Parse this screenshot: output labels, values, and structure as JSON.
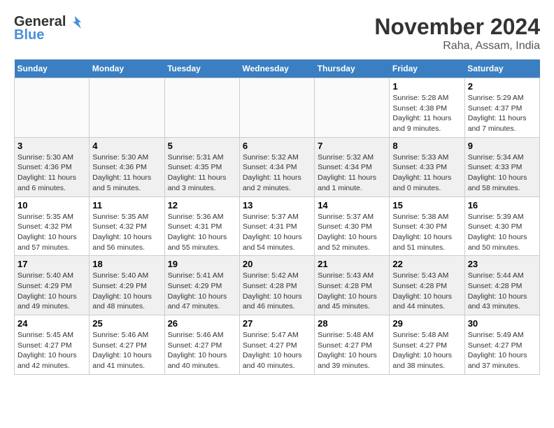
{
  "header": {
    "logo_line1": "General",
    "logo_line2": "Blue",
    "title": "November 2024",
    "location": "Raha, Assam, India"
  },
  "weekdays": [
    "Sunday",
    "Monday",
    "Tuesday",
    "Wednesday",
    "Thursday",
    "Friday",
    "Saturday"
  ],
  "weeks": [
    [
      {
        "day": "",
        "info": ""
      },
      {
        "day": "",
        "info": ""
      },
      {
        "day": "",
        "info": ""
      },
      {
        "day": "",
        "info": ""
      },
      {
        "day": "",
        "info": ""
      },
      {
        "day": "1",
        "info": "Sunrise: 5:28 AM\nSunset: 4:38 PM\nDaylight: 11 hours\nand 9 minutes."
      },
      {
        "day": "2",
        "info": "Sunrise: 5:29 AM\nSunset: 4:37 PM\nDaylight: 11 hours\nand 7 minutes."
      }
    ],
    [
      {
        "day": "3",
        "info": "Sunrise: 5:30 AM\nSunset: 4:36 PM\nDaylight: 11 hours\nand 6 minutes."
      },
      {
        "day": "4",
        "info": "Sunrise: 5:30 AM\nSunset: 4:36 PM\nDaylight: 11 hours\nand 5 minutes."
      },
      {
        "day": "5",
        "info": "Sunrise: 5:31 AM\nSunset: 4:35 PM\nDaylight: 11 hours\nand 3 minutes."
      },
      {
        "day": "6",
        "info": "Sunrise: 5:32 AM\nSunset: 4:34 PM\nDaylight: 11 hours\nand 2 minutes."
      },
      {
        "day": "7",
        "info": "Sunrise: 5:32 AM\nSunset: 4:34 PM\nDaylight: 11 hours\nand 1 minute."
      },
      {
        "day": "8",
        "info": "Sunrise: 5:33 AM\nSunset: 4:33 PM\nDaylight: 11 hours\nand 0 minutes."
      },
      {
        "day": "9",
        "info": "Sunrise: 5:34 AM\nSunset: 4:33 PM\nDaylight: 10 hours\nand 58 minutes."
      }
    ],
    [
      {
        "day": "10",
        "info": "Sunrise: 5:35 AM\nSunset: 4:32 PM\nDaylight: 10 hours\nand 57 minutes."
      },
      {
        "day": "11",
        "info": "Sunrise: 5:35 AM\nSunset: 4:32 PM\nDaylight: 10 hours\nand 56 minutes."
      },
      {
        "day": "12",
        "info": "Sunrise: 5:36 AM\nSunset: 4:31 PM\nDaylight: 10 hours\nand 55 minutes."
      },
      {
        "day": "13",
        "info": "Sunrise: 5:37 AM\nSunset: 4:31 PM\nDaylight: 10 hours\nand 54 minutes."
      },
      {
        "day": "14",
        "info": "Sunrise: 5:37 AM\nSunset: 4:30 PM\nDaylight: 10 hours\nand 52 minutes."
      },
      {
        "day": "15",
        "info": "Sunrise: 5:38 AM\nSunset: 4:30 PM\nDaylight: 10 hours\nand 51 minutes."
      },
      {
        "day": "16",
        "info": "Sunrise: 5:39 AM\nSunset: 4:30 PM\nDaylight: 10 hours\nand 50 minutes."
      }
    ],
    [
      {
        "day": "17",
        "info": "Sunrise: 5:40 AM\nSunset: 4:29 PM\nDaylight: 10 hours\nand 49 minutes."
      },
      {
        "day": "18",
        "info": "Sunrise: 5:40 AM\nSunset: 4:29 PM\nDaylight: 10 hours\nand 48 minutes."
      },
      {
        "day": "19",
        "info": "Sunrise: 5:41 AM\nSunset: 4:29 PM\nDaylight: 10 hours\nand 47 minutes."
      },
      {
        "day": "20",
        "info": "Sunrise: 5:42 AM\nSunset: 4:28 PM\nDaylight: 10 hours\nand 46 minutes."
      },
      {
        "day": "21",
        "info": "Sunrise: 5:43 AM\nSunset: 4:28 PM\nDaylight: 10 hours\nand 45 minutes."
      },
      {
        "day": "22",
        "info": "Sunrise: 5:43 AM\nSunset: 4:28 PM\nDaylight: 10 hours\nand 44 minutes."
      },
      {
        "day": "23",
        "info": "Sunrise: 5:44 AM\nSunset: 4:28 PM\nDaylight: 10 hours\nand 43 minutes."
      }
    ],
    [
      {
        "day": "24",
        "info": "Sunrise: 5:45 AM\nSunset: 4:27 PM\nDaylight: 10 hours\nand 42 minutes."
      },
      {
        "day": "25",
        "info": "Sunrise: 5:46 AM\nSunset: 4:27 PM\nDaylight: 10 hours\nand 41 minutes."
      },
      {
        "day": "26",
        "info": "Sunrise: 5:46 AM\nSunset: 4:27 PM\nDaylight: 10 hours\nand 40 minutes."
      },
      {
        "day": "27",
        "info": "Sunrise: 5:47 AM\nSunset: 4:27 PM\nDaylight: 10 hours\nand 40 minutes."
      },
      {
        "day": "28",
        "info": "Sunrise: 5:48 AM\nSunset: 4:27 PM\nDaylight: 10 hours\nand 39 minutes."
      },
      {
        "day": "29",
        "info": "Sunrise: 5:48 AM\nSunset: 4:27 PM\nDaylight: 10 hours\nand 38 minutes."
      },
      {
        "day": "30",
        "info": "Sunrise: 5:49 AM\nSunset: 4:27 PM\nDaylight: 10 hours\nand 37 minutes."
      }
    ]
  ]
}
